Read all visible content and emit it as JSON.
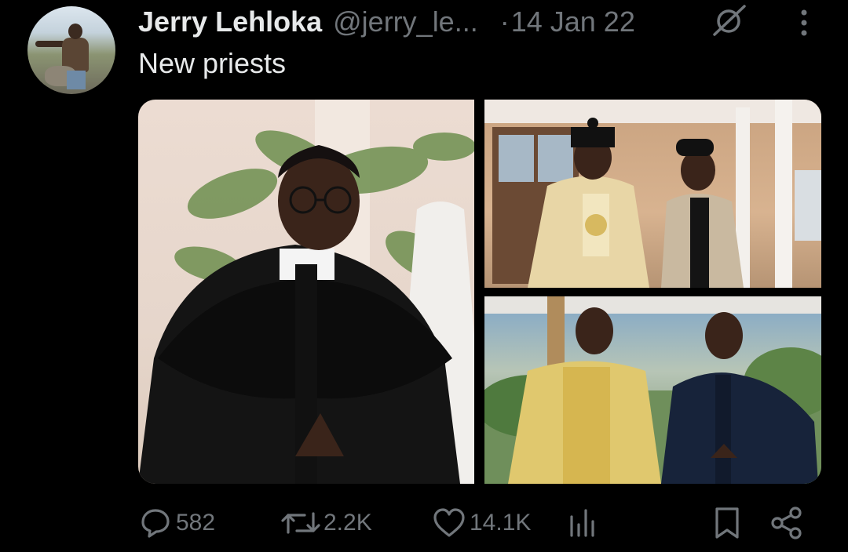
{
  "tweet": {
    "author_name": "Jerry Lehloka",
    "author_handle": "@jerry_le...",
    "separator": "·",
    "date": "14 Jan 22",
    "text": "New priests"
  },
  "media": {
    "photo_count": 3
  },
  "actions": {
    "replies": "582",
    "retweets": "2.2K",
    "likes": "14.1K"
  },
  "icons": {
    "grok": "grok-slash-icon",
    "more": "more-vertical-icon",
    "reply": "reply-icon",
    "retweet": "retweet-icon",
    "like": "heart-icon",
    "views": "views-icon",
    "bookmark": "bookmark-icon",
    "share": "share-icon"
  },
  "colors": {
    "background": "#000000",
    "text_primary": "#e7e9ea",
    "text_secondary": "#71767b"
  }
}
